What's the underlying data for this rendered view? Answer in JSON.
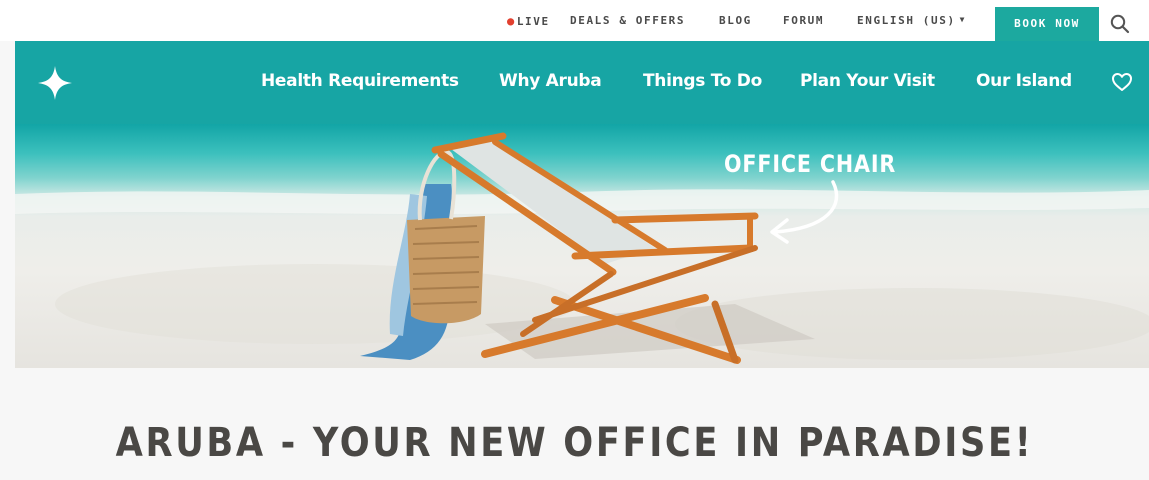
{
  "topbar": {
    "live_label": "LIVE",
    "deals_label": "DEALS & OFFERS",
    "blog_label": "BLOG",
    "forum_label": "FORUM",
    "language_label": "ENGLISH (US)",
    "book_now_label": "BOOK NOW",
    "live_dot_color": "#e2402f",
    "book_now_color": "#1ca99f"
  },
  "nav": {
    "items": [
      {
        "label": "Health Requirements"
      },
      {
        "label": "Why Aruba"
      },
      {
        "label": "Things To Do"
      },
      {
        "label": "Plan Your Visit"
      },
      {
        "label": "Our Island"
      }
    ],
    "background_color": "#17a5a4"
  },
  "hero": {
    "annotation": "OFFICE CHAIR"
  },
  "headline": "ARUBA - YOUR NEW OFFICE IN PARADISE!"
}
